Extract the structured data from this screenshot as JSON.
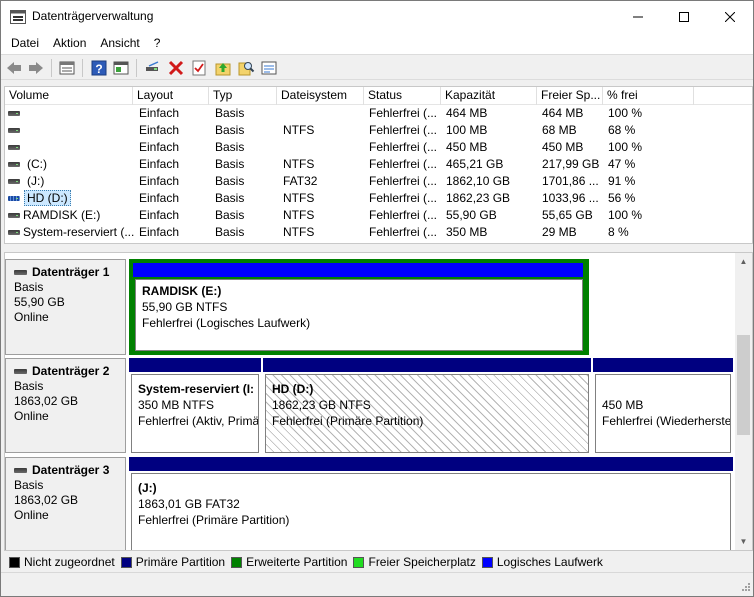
{
  "window": {
    "title": "Datenträgerverwaltung"
  },
  "menu": [
    {
      "name": "menu-datei",
      "label": "Datei"
    },
    {
      "name": "menu-aktion",
      "label": "Aktion"
    },
    {
      "name": "menu-ansicht",
      "label": "Ansicht"
    },
    {
      "name": "menu-help",
      "label": "?"
    }
  ],
  "toolbar": {
    "icons": [
      "back-icon",
      "forward-icon",
      "properties-icon",
      "help-icon",
      "console-icon",
      "connect-icon",
      "delete-icon",
      "checklist-icon",
      "folder-up-icon",
      "search-icon",
      "view-icon"
    ]
  },
  "volume_list": {
    "columns": [
      "Volume",
      "Layout",
      "Typ",
      "Dateisystem",
      "Status",
      "Kapazität",
      "Freier Sp...",
      "% frei"
    ],
    "rows": [
      {
        "volume": "",
        "layout": "Einfach",
        "type": "Basis",
        "fs": "",
        "status": "Fehlerfrei (...",
        "capacity": "464 MB",
        "free": "464 MB",
        "pct": "100 %"
      },
      {
        "volume": "",
        "layout": "Einfach",
        "type": "Basis",
        "fs": "NTFS",
        "status": "Fehlerfrei (...",
        "capacity": "100 MB",
        "free": "68 MB",
        "pct": "68 %"
      },
      {
        "volume": "",
        "layout": "Einfach",
        "type": "Basis",
        "fs": "",
        "status": "Fehlerfrei (...",
        "capacity": "450 MB",
        "free": "450 MB",
        "pct": "100 %"
      },
      {
        "volume": "(C:)",
        "layout": "Einfach",
        "type": "Basis",
        "fs": "NTFS",
        "status": "Fehlerfrei (...",
        "capacity": "465,21 GB",
        "free": "217,99 GB",
        "pct": "47 %"
      },
      {
        "volume": "(J:)",
        "layout": "Einfach",
        "type": "Basis",
        "fs": "FAT32",
        "status": "Fehlerfrei (...",
        "capacity": "1862,10 GB",
        "free": "1701,86 ...",
        "pct": "91 %"
      },
      {
        "volume": "HD (D:)",
        "layout": "Einfach",
        "type": "Basis",
        "fs": "NTFS",
        "status": "Fehlerfrei (...",
        "capacity": "1862,23 GB",
        "free": "1033,96 ...",
        "pct": "56 %"
      },
      {
        "volume": "RAMDISK (E:)",
        "layout": "Einfach",
        "type": "Basis",
        "fs": "NTFS",
        "status": "Fehlerfrei (...",
        "capacity": "55,90 GB",
        "free": "55,65 GB",
        "pct": "100 %"
      },
      {
        "volume": "System-reserviert (...",
        "layout": "Einfach",
        "type": "Basis",
        "fs": "NTFS",
        "status": "Fehlerfrei (...",
        "capacity": "350 MB",
        "free": "29 MB",
        "pct": "8 %"
      }
    ]
  },
  "disks": [
    {
      "title": "Datenträger 1",
      "type": "Basis",
      "size": "55,90 GB",
      "state": "Online",
      "partitions": [
        {
          "name": "RAMDISK  (E:)",
          "line1": "55,90 GB NTFS",
          "line2": "Fehlerfrei (Logisches Laufwerk)"
        }
      ]
    },
    {
      "title": "Datenträger 2",
      "type": "Basis",
      "size": "1863,02 GB",
      "state": "Online",
      "partitions": [
        {
          "name": "System-reserviert  (I:",
          "line1": "350 MB NTFS",
          "line2": "Fehlerfrei (Aktiv, Primä"
        },
        {
          "name": "HD  (D:)",
          "line1": "1862,23 GB NTFS",
          "line2": "Fehlerfrei (Primäre Partition)"
        },
        {
          "name": "",
          "line1": "450 MB",
          "line2": "Fehlerfrei (Wiederherste"
        }
      ]
    },
    {
      "title": "Datenträger 3",
      "type": "Basis",
      "size": "1863,02 GB",
      "state": "Online",
      "partitions": [
        {
          "name": "(J:)",
          "line1": "1863,01 GB FAT32",
          "line2": "Fehlerfrei (Primäre Partition)"
        }
      ]
    }
  ],
  "legend": [
    {
      "label": "Nicht zugeordnet",
      "color": "#000000"
    },
    {
      "label": "Primäre Partition",
      "color": "#000080"
    },
    {
      "label": "Erweiterte Partition",
      "color": "#008000"
    },
    {
      "label": "Freier Speicherplatz",
      "color": "#22dd22"
    },
    {
      "label": "Logisches Laufwerk",
      "color": "#0000ff"
    }
  ]
}
